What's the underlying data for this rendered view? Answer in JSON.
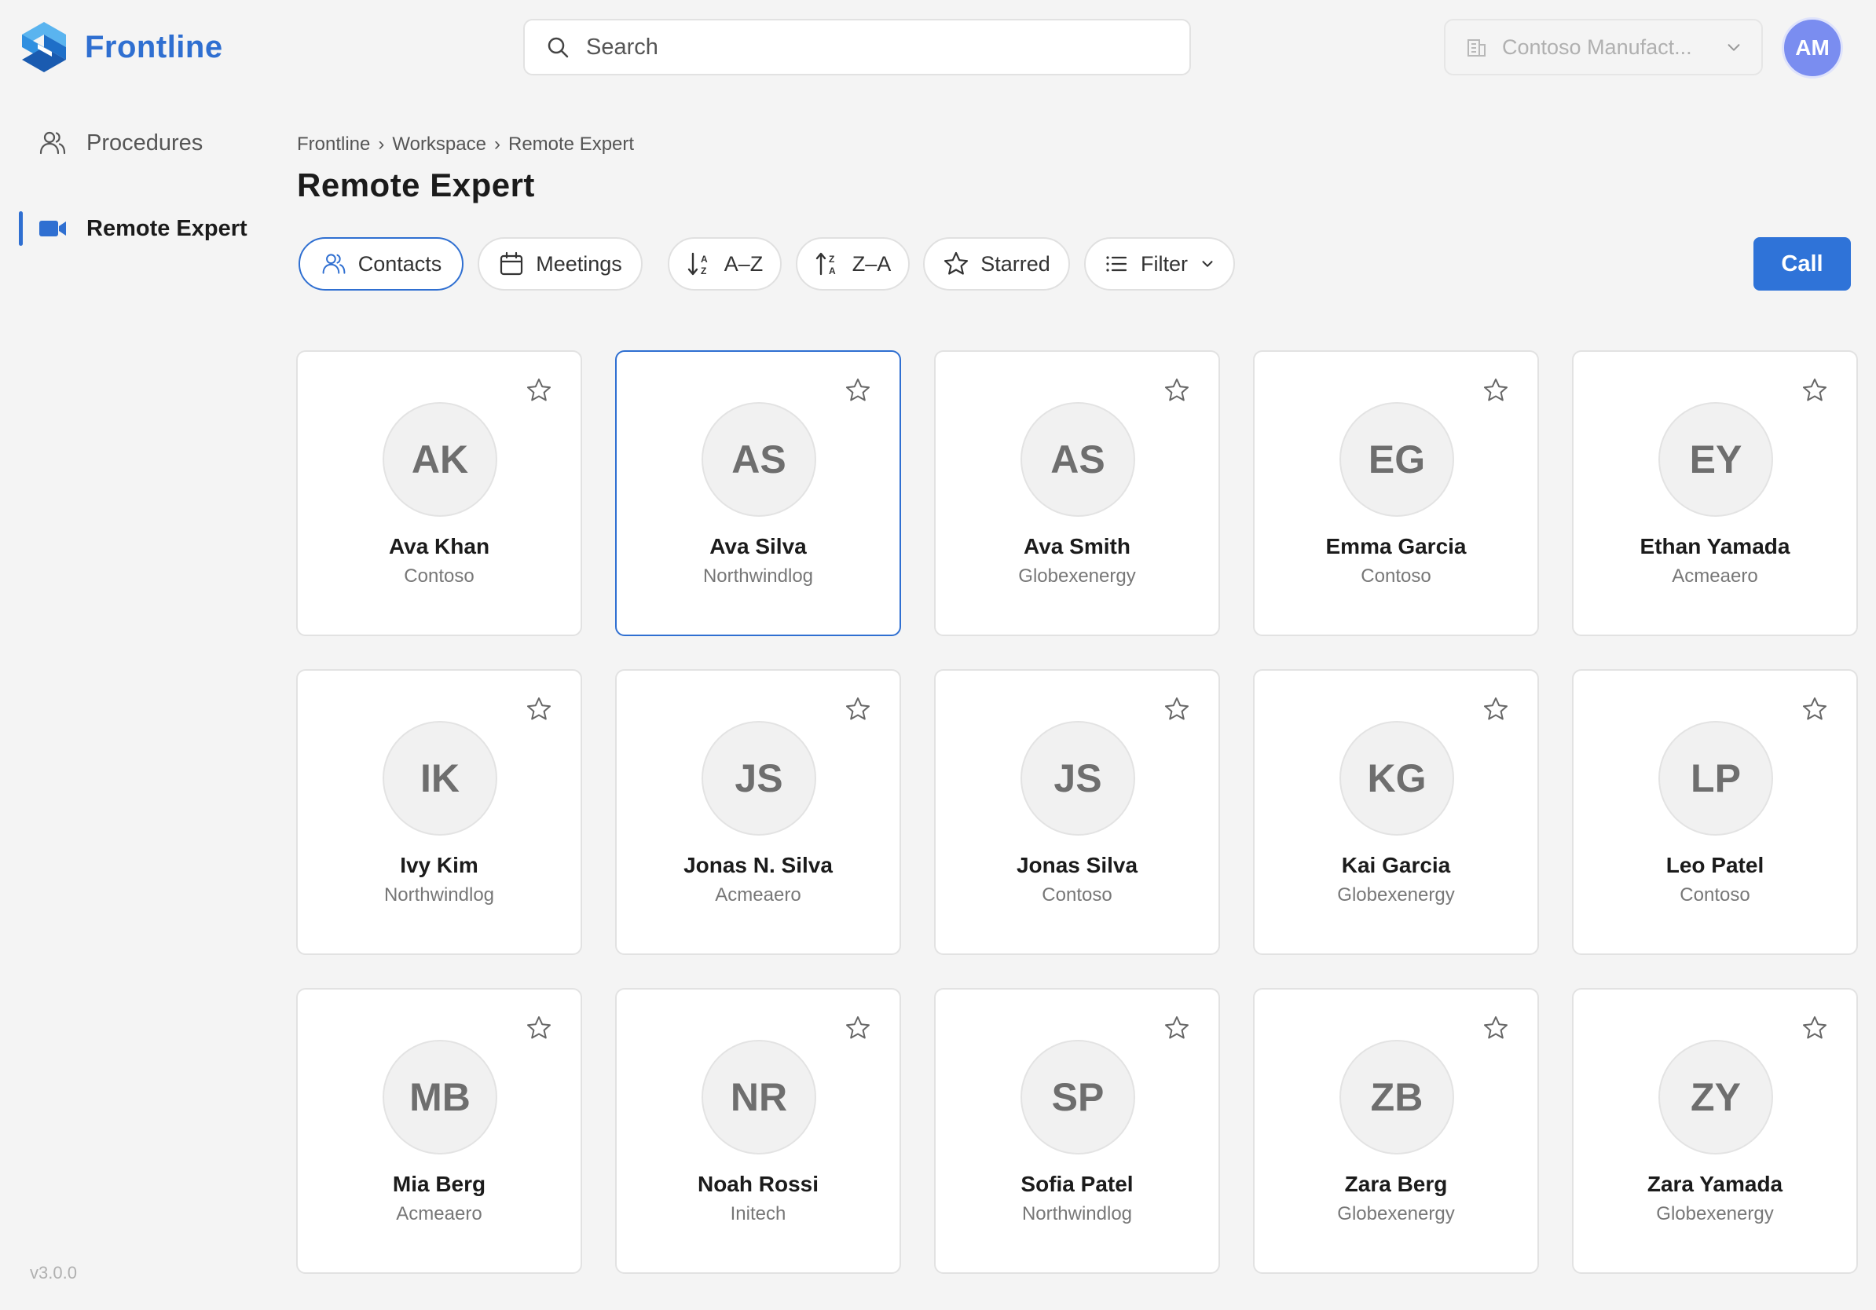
{
  "app": {
    "name": "Frontline",
    "version": "v3.0.0"
  },
  "header": {
    "search_placeholder": "Search",
    "org_selected": "Contoso Manufact...",
    "user_initials": "AM"
  },
  "sidebar": {
    "items": [
      {
        "label": "Procedures",
        "icon": "users-icon",
        "active": false
      },
      {
        "label": "Remote Expert",
        "icon": "video-camera-icon",
        "active": true
      }
    ]
  },
  "breadcrumb": [
    "Frontline",
    "›",
    "Workspace",
    "›",
    "Remote Expert"
  ],
  "page": {
    "title": "Remote Expert"
  },
  "toolbar": {
    "contacts": "Contacts",
    "meetings": "Meetings",
    "sort_az": "A–Z",
    "sort_za": "Z–A",
    "starred": "Starred",
    "filter": "Filter",
    "call": "Call"
  },
  "contacts": [
    {
      "initials": "AK",
      "name": "Ava Khan",
      "company": "Contoso"
    },
    {
      "initials": "AS",
      "name": "Ava Silva",
      "company": "Northwindlog",
      "selected": true
    },
    {
      "initials": "AS",
      "name": "Ava Smith",
      "company": "Globexenergy"
    },
    {
      "initials": "EG",
      "name": "Emma Garcia",
      "company": "Contoso"
    },
    {
      "initials": "EY",
      "name": "Ethan Yamada",
      "company": "Acmeaero"
    },
    {
      "initials": "IK",
      "name": "Ivy Kim",
      "company": "Northwindlog"
    },
    {
      "initials": "JS",
      "name": "Jonas N. Silva",
      "company": "Acmeaero"
    },
    {
      "initials": "JS",
      "name": "Jonas Silva",
      "company": "Contoso"
    },
    {
      "initials": "KG",
      "name": "Kai Garcia",
      "company": "Globexenergy"
    },
    {
      "initials": "LP",
      "name": "Leo Patel",
      "company": "Contoso"
    },
    {
      "initials": "MB",
      "name": "Mia Berg",
      "company": "Acmeaero"
    },
    {
      "initials": "NR",
      "name": "Noah Rossi",
      "company": "Initech"
    },
    {
      "initials": "SP",
      "name": "Sofia Patel",
      "company": "Northwindlog"
    },
    {
      "initials": "ZB",
      "name": "Zara Berg",
      "company": "Globexenergy"
    },
    {
      "initials": "ZY",
      "name": "Zara Yamada",
      "company": "Globexenergy"
    }
  ],
  "colors": {
    "accent": "#2f6fd1",
    "background": "#f4f4f4",
    "avatar_user": "#7a8df0"
  }
}
